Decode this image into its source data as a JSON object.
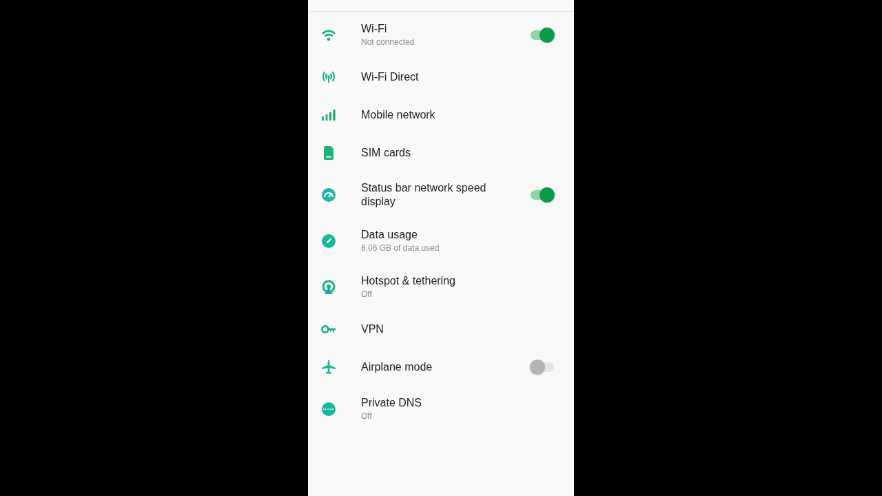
{
  "settings": [
    {
      "kind": "toggle",
      "title": "Wi-Fi",
      "subtitle": "Not connected",
      "on": true
    },
    {
      "kind": "link",
      "title": "Wi-Fi Direct"
    },
    {
      "kind": "link",
      "title": "Mobile network"
    },
    {
      "kind": "link",
      "title": "SIM cards"
    },
    {
      "kind": "toggle",
      "title": "Status bar network speed display",
      "on": true
    },
    {
      "kind": "link",
      "title": "Data usage",
      "subtitle": "8.06 GB of data used"
    },
    {
      "kind": "link",
      "title": "Hotspot & tethering",
      "subtitle": "Off"
    },
    {
      "kind": "link",
      "title": "VPN"
    },
    {
      "kind": "toggle",
      "title": "Airplane mode",
      "on": false
    },
    {
      "kind": "link",
      "title": "Private DNS",
      "subtitle": "Off"
    }
  ]
}
